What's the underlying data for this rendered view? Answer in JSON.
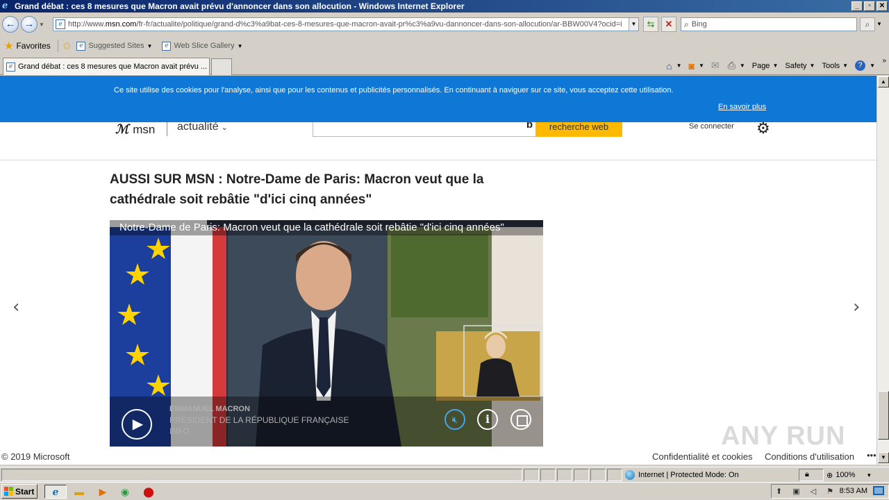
{
  "window": {
    "title": "Grand débat : ces 8 mesures que Macron avait prévu d'annoncer dans son allocution - Windows Internet Explorer",
    "buttons": [
      "_",
      "▫",
      "✕"
    ]
  },
  "navbar": {
    "url_prefix": "http://www.",
    "url_domain": "msn.com",
    "url_rest": "/fr-fr/actualite/politique/grand-d%c3%a9bat-ces-8-mesures-que-macron-avait-pr%c3%a9vu-dannoncer-dans-son-allocution/ar-BBW00V4?ocid=i",
    "search_placeholder": "Bing"
  },
  "favbar": {
    "favorites_label": "Favorites",
    "links": [
      {
        "label": "Suggested Sites"
      },
      {
        "label": "Web Slice Gallery"
      }
    ]
  },
  "tabs": {
    "active_label": "Grand débat : ces 8 mesures que Macron avait prévu ..."
  },
  "cmdbar": {
    "page": "Page",
    "safety": "Safety",
    "tools": "Tools"
  },
  "cookie": {
    "message": "Ce site utilise des cookies pour l'analyse, ainsi que pour les contenus et publicités personnalisés. En continuant à naviguer sur ce site, vous acceptez cette utilisation.",
    "learn_more": "En savoir plus"
  },
  "msn": {
    "logo": "msn",
    "section": "actualité",
    "search_button": "recherche web",
    "signin": "Se connecter"
  },
  "article": {
    "headline": "AUSSI SUR MSN : Notre-Dame de Paris: Macron veut que la cathédrale soit rebâtie \"d'ici cinq années\"",
    "video_title": "Notre-Dame de Paris: Macron veut que la cathédrale soit rebâtie \"d'ici cinq années\"",
    "nameplate_name": "EMMANUEL MACRON",
    "nameplate_role": "PRÉSIDENT DE LA RÉPUBLIQUE FRANÇAISE",
    "channel_fragment": "INFO"
  },
  "footer": {
    "copyright": "© 2019 Microsoft",
    "privacy": "Confidentialité et cookies",
    "terms": "Conditions d'utilisation",
    "more": "•••"
  },
  "watermark": "ANY RUN",
  "statusbar": {
    "zone": "Internet | Protected Mode: On",
    "zoom": "100%"
  },
  "taskbar": {
    "start": "Start",
    "clock": "8:53 AM"
  },
  "colors": {
    "cookie_banner": "#0f78d7",
    "search_button": "#ffb900",
    "titlebar": "#0a246a"
  }
}
